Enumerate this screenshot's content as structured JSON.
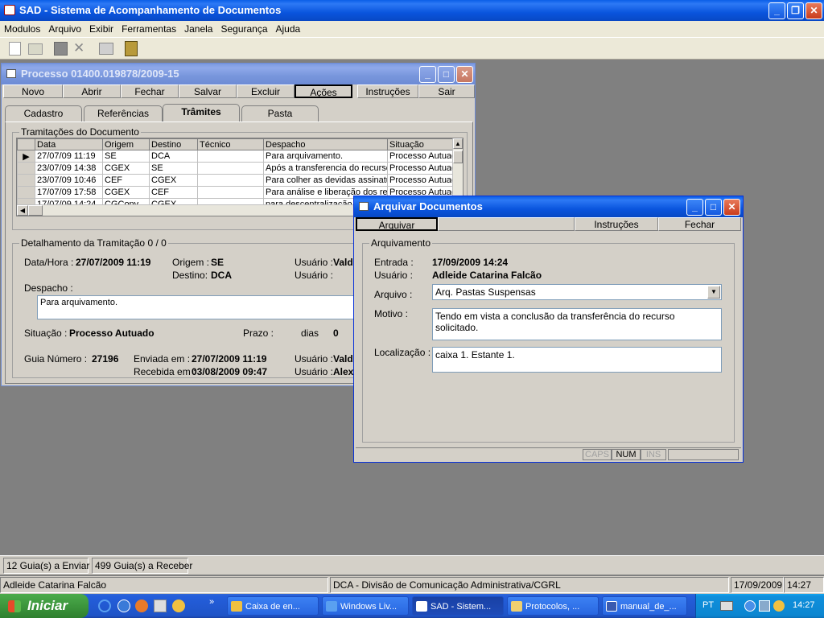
{
  "app": {
    "title": "SAD - Sistema de Acompanhamento de Documentos",
    "menu": [
      "Modulos",
      "Arquivo",
      "Exibir",
      "Ferramentas",
      "Janela",
      "Segurança",
      "Ajuda"
    ]
  },
  "processo": {
    "title": "Processo 01400.019878/2009-15",
    "buttons": [
      "Novo",
      "Abrir",
      "Fechar",
      "Salvar",
      "Excluir",
      "Ações",
      "Instruções",
      "Sair"
    ],
    "tabs": [
      "Cadastro",
      "Referências",
      "Trâmites",
      "Pasta"
    ],
    "active_tab": "Trâmites",
    "group_title": "Tramitações do Documento",
    "columns": [
      "Data",
      "Origem",
      "Destino",
      "Técnico",
      "Despacho",
      "Situação"
    ],
    "rows": [
      [
        "27/07/09 11:19",
        "SE",
        "DCA",
        "",
        "Para arquivamento.",
        "Processo Autuado"
      ],
      [
        "23/07/09 14:38",
        "CGEX",
        "SE",
        "",
        "Após a transferencia do recurso",
        "Processo Autuado"
      ],
      [
        "23/07/09 10:46",
        "CEF",
        "CGEX",
        "",
        "Para colher as devidas assinaturas",
        "Processo Autuado"
      ],
      [
        "17/07/09 17:58",
        "CGEX",
        "CEF",
        "",
        "Para análise e liberação dos recursos",
        "Processo Autuado"
      ],
      [
        "17/07/09 14:24",
        "CGConv",
        "CGEX",
        "",
        "para descentralização",
        ""
      ]
    ],
    "detail": {
      "title": "Detalhamento da Tramitação",
      "counter": "0 / 0",
      "datahora_label": "Data/Hora :",
      "datahora": "27/07/2009 11:19",
      "origem_label": "Origem :",
      "origem": "SE",
      "destino_label": "Destino:",
      "destino": "DCA",
      "usuario_label": "Usuário :",
      "usuario1": "Vald",
      "despacho_label": "Despacho :",
      "despacho": "Para arquivamento.",
      "situacao_label": "Situação :",
      "situacao": "Processo Autuado",
      "prazo_label": "Prazo :",
      "dias_label": "dias",
      "dias": "0",
      "guia_label": "Guia Número :",
      "guia": "27196",
      "enviada_label": "Enviada em :",
      "enviada": "27/07/2009 11:19",
      "recebida_label": "Recebida em :",
      "recebida": "03/08/2009 09:47",
      "usuario_env": "Vald",
      "usuario_rec": "Alex"
    }
  },
  "arquivar": {
    "title": "Arquivar Documentos",
    "buttons": [
      "Arquivar",
      "Instruções",
      "Fechar"
    ],
    "group_title": "Arquivamento",
    "entrada_label": "Entrada :",
    "entrada": "17/09/2009 14:24",
    "usuario_label": "Usuário :",
    "usuario": "Adleide Catarina Falcão",
    "arquivo_label": "Arquivo :",
    "arquivo": "Arq. Pastas Suspensas",
    "motivo_label": "Motivo :",
    "motivo": "Tendo em vista a conclusão da transferência do recurso solicitado.",
    "localizacao_label": "Localização :",
    "localizacao": "caixa 1. Estante 1.",
    "status": [
      "CAPS",
      "NUM",
      "INS"
    ]
  },
  "bottom": {
    "guias_enviar": "12 Guia(s) a Enviar",
    "guias_receber": "499 Guia(s) a Receber",
    "user": "Adleide Catarina Falcão",
    "unit": "DCA - Divisão de Comunicação Administrativa/CGRL",
    "date": "17/09/2009",
    "time": "14:27"
  },
  "taskbar": {
    "start": "Iniciar",
    "tasks": [
      "Caixa de en...",
      "Windows Liv...",
      "SAD - Sistem...",
      "Protocolos, ...",
      "manual_de_..."
    ],
    "lang": "PT",
    "clock": "14:27"
  },
  "colors": {
    "xp_blue": "#0a55de",
    "window_face": "#d4d0c8",
    "desktop": "#808080"
  }
}
